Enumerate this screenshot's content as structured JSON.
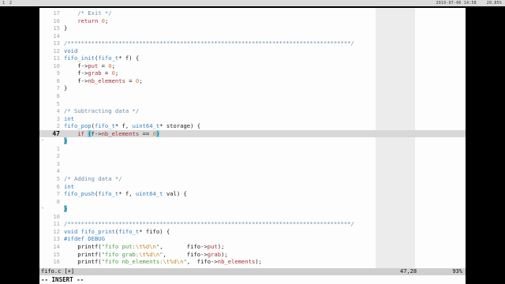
{
  "topbar": {
    "workspaces": [
      "1",
      "2"
    ],
    "datetime": "2019-07-06 14:58",
    "battery": "20.85%"
  },
  "editor": {
    "lines": [
      {
        "num": "17",
        "sign": "",
        "tokens": [
          [
            "t-txt",
            "    "
          ],
          [
            "t-com",
            "/* Exit */"
          ]
        ]
      },
      {
        "num": "16",
        "sign": "",
        "tokens": [
          [
            "t-txt",
            "    "
          ],
          [
            "t-kw",
            "return"
          ],
          [
            "t-txt",
            " "
          ],
          [
            "t-num",
            "0"
          ],
          [
            "t-txt",
            ";"
          ]
        ]
      },
      {
        "num": "15",
        "sign": "",
        "tokens": [
          [
            "t-txt",
            "}"
          ]
        ]
      },
      {
        "num": "14",
        "sign": "",
        "tokens": []
      },
      {
        "num": "13",
        "sign": "",
        "tokens": [
          [
            "t-com",
            "/***********************************************************************************/"
          ]
        ]
      },
      {
        "num": "12",
        "sign": "",
        "tokens": [
          [
            "t-typ",
            "void"
          ]
        ]
      },
      {
        "num": "11",
        "sign": "",
        "tokens": [
          [
            "t-fn",
            "fifo_init"
          ],
          [
            "t-txt",
            "("
          ],
          [
            "t-typ",
            "fifo_t"
          ],
          [
            "t-txt",
            "* f) {"
          ]
        ]
      },
      {
        "num": "10",
        "sign": "",
        "tokens": [
          [
            "t-txt",
            "    f->"
          ],
          [
            "t-mem",
            "put"
          ],
          [
            "t-txt",
            " = "
          ],
          [
            "t-num",
            "0"
          ],
          [
            "t-txt",
            ";"
          ]
        ]
      },
      {
        "num": "9",
        "sign": "",
        "tokens": [
          [
            "t-txt",
            "    f->"
          ],
          [
            "t-mem",
            "grab"
          ],
          [
            "t-txt",
            " = "
          ],
          [
            "t-num",
            "0"
          ],
          [
            "t-txt",
            ";"
          ]
        ]
      },
      {
        "num": "8",
        "sign": "",
        "tokens": [
          [
            "t-txt",
            "    f->"
          ],
          [
            "t-mem",
            "nb_elements"
          ],
          [
            "t-txt",
            " = "
          ],
          [
            "t-num",
            "0"
          ],
          [
            "t-txt",
            ";"
          ]
        ]
      },
      {
        "num": "7",
        "sign": "",
        "tokens": [
          [
            "t-txt",
            "}"
          ]
        ]
      },
      {
        "num": "6",
        "sign": "",
        "tokens": []
      },
      {
        "num": "5",
        "sign": "",
        "tokens": []
      },
      {
        "num": "4",
        "sign": "",
        "tokens": [
          [
            "t-com",
            "/* Subtracting data */"
          ]
        ]
      },
      {
        "num": "3",
        "sign": "",
        "tokens": [
          [
            "t-typ",
            "int"
          ]
        ]
      },
      {
        "num": "2",
        "sign": "",
        "tokens": [
          [
            "t-fn",
            "fifo_pop"
          ],
          [
            "t-txt",
            "("
          ],
          [
            "t-typ",
            "fifo_t"
          ],
          [
            "t-txt",
            "* f, "
          ],
          [
            "t-typ",
            "uint64_t"
          ],
          [
            "t-txt",
            "* storage) {"
          ]
        ]
      },
      {
        "num": "1",
        "sign": "",
        "tokens": [
          [
            "t-txt",
            "    "
          ],
          [
            "t-kw",
            "if"
          ],
          [
            "t-txt",
            " "
          ],
          [
            "t-brk",
            "("
          ],
          [
            "t-txt",
            "f->"
          ],
          [
            "t-mem",
            "nb_elements"
          ],
          [
            "t-txt",
            " == "
          ],
          [
            "t-num",
            "0"
          ],
          [
            "t-brk",
            ")"
          ]
        ],
        "current": true,
        "curnum": "47"
      },
      {
        "num": "",
        "sign": "-",
        "tokens": [
          [
            "t-brk",
            "}"
          ]
        ]
      },
      {
        "num": "1",
        "sign": "",
        "tokens": []
      },
      {
        "num": "2",
        "sign": "",
        "tokens": []
      },
      {
        "num": "3",
        "sign": "",
        "tokens": []
      },
      {
        "num": "4",
        "sign": "",
        "tokens": []
      },
      {
        "num": "5",
        "sign": "",
        "tokens": [
          [
            "t-com",
            "/* Adding data */"
          ]
        ]
      },
      {
        "num": "6",
        "sign": "",
        "tokens": [
          [
            "t-typ",
            "int"
          ]
        ]
      },
      {
        "num": "7",
        "sign": "",
        "tokens": [
          [
            "t-fn",
            "fifo_push"
          ],
          [
            "t-txt",
            "("
          ],
          [
            "t-typ",
            "fifo_t"
          ],
          [
            "t-txt",
            "* f, "
          ],
          [
            "t-typ",
            "uint64_t"
          ],
          [
            "t-txt",
            " val) {"
          ]
        ]
      },
      {
        "num": "8",
        "sign": "",
        "tokens": []
      },
      {
        "num": "",
        "sign": "-",
        "tokens": [
          [
            "t-brk",
            "}"
          ]
        ]
      },
      {
        "num": "10",
        "sign": "",
        "tokens": []
      },
      {
        "num": "11",
        "sign": "",
        "tokens": [
          [
            "t-com",
            "/***********************************************************************************/"
          ]
        ]
      },
      {
        "num": "12",
        "sign": "",
        "tokens": [
          [
            "t-typ",
            "void"
          ],
          [
            "t-txt",
            " "
          ],
          [
            "t-fn",
            "fifo_print"
          ],
          [
            "t-txt",
            "("
          ],
          [
            "t-typ",
            "fifo_t"
          ],
          [
            "t-txt",
            "* fifo) {"
          ]
        ]
      },
      {
        "num": "13",
        "sign": "",
        "tokens": [
          [
            "t-pre",
            "#ifdef DEBUG"
          ]
        ]
      },
      {
        "num": "14",
        "sign": "",
        "tokens": [
          [
            "t-txt",
            "    printf("
          ],
          [
            "t-str",
            "\"fifo put:"
          ],
          [
            "t-esc",
            "\\t%d\\n"
          ],
          [
            "t-str",
            "\""
          ],
          [
            "t-txt",
            ",       fifo->"
          ],
          [
            "t-mem",
            "put"
          ],
          [
            "t-txt",
            ");"
          ]
        ]
      },
      {
        "num": "15",
        "sign": "",
        "tokens": [
          [
            "t-txt",
            "    printf("
          ],
          [
            "t-str",
            "\"fifo grab:"
          ],
          [
            "t-esc",
            "\\t%d\\n"
          ],
          [
            "t-str",
            "\""
          ],
          [
            "t-txt",
            ",      fifo->"
          ],
          [
            "t-mem",
            "grab"
          ],
          [
            "t-txt",
            ");"
          ]
        ]
      },
      {
        "num": "16",
        "sign": "",
        "tokens": [
          [
            "t-txt",
            "    printf("
          ],
          [
            "t-str",
            "\"fifo nb_elements:"
          ],
          [
            "t-esc",
            "\\t%d\\n"
          ],
          [
            "t-str",
            "\""
          ],
          [
            "t-txt",
            ",  fifo->"
          ],
          [
            "t-mem",
            "nb_elements"
          ],
          [
            "t-txt",
            ");"
          ]
        ]
      }
    ]
  },
  "statusline": {
    "filename": "fifo.c [+]",
    "position": "47,28",
    "percent": "93%"
  },
  "cmdline": {
    "mode": "-- INSERT --"
  }
}
